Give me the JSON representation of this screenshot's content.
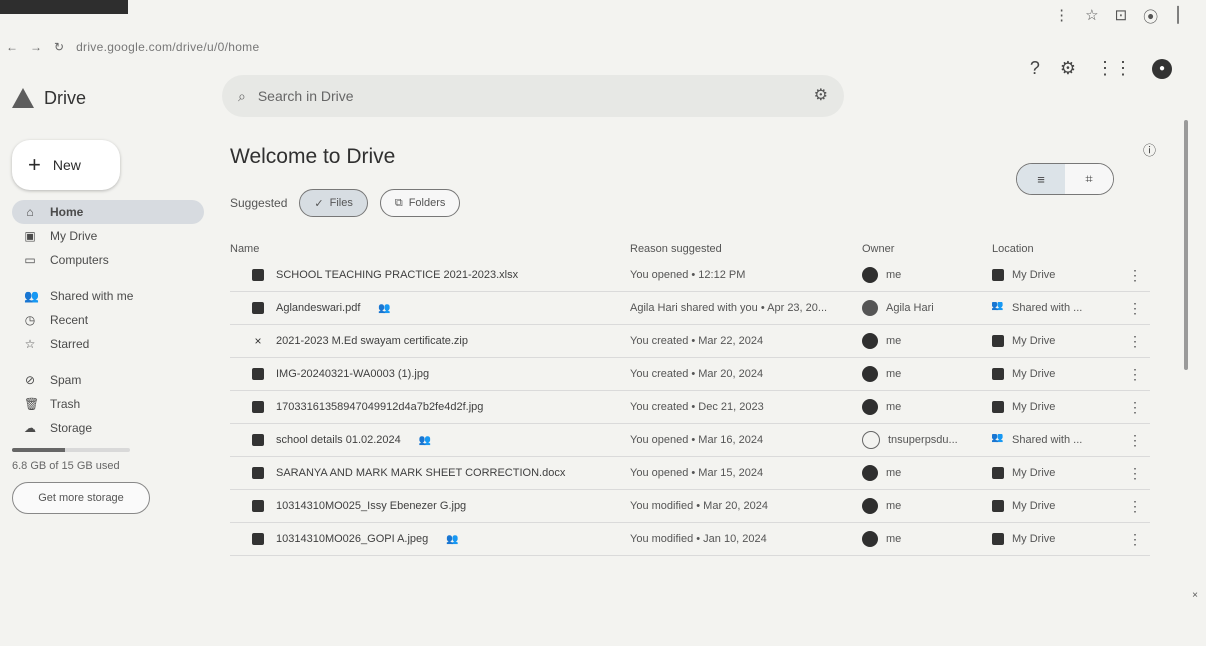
{
  "browser": {
    "url": "drive.google.com/drive/u/0/home",
    "nav": {
      "back": "←",
      "forward": "→",
      "reload": "↻"
    },
    "controls": [
      "⋮",
      "☆",
      "⊡",
      "⦿",
      "⎮"
    ]
  },
  "app": {
    "name": "Drive",
    "new_label": "New",
    "search_placeholder": "Search in Drive",
    "title": "Welcome to Drive",
    "suggested_label": "Suggested",
    "chips": [
      {
        "label": "Files",
        "icon": "check-icon",
        "active": true
      },
      {
        "label": "Folders",
        "icon": "folder-icon",
        "active": false
      }
    ],
    "view_toggle": {
      "list_label": "≡",
      "grid_label": "⌗"
    },
    "top_icons": [
      "help-icon",
      "settings-icon",
      "apps-icon",
      "avatar-icon"
    ],
    "info_icon": "info-icon"
  },
  "sidebar": {
    "items": [
      {
        "label": "Home",
        "icon": "home-icon",
        "active": true
      },
      {
        "label": "My Drive",
        "icon": "drive-icon",
        "active": false
      },
      {
        "label": "Computers",
        "icon": "computer-icon",
        "active": false
      },
      {
        "label": "Shared with me",
        "icon": "people-icon",
        "active": false
      },
      {
        "label": "Recent",
        "icon": "clock-icon",
        "active": false
      },
      {
        "label": "Starred",
        "icon": "star-icon",
        "active": false
      },
      {
        "label": "Spam",
        "icon": "spam-icon",
        "active": false
      },
      {
        "label": "Trash",
        "icon": "trash-icon",
        "active": false
      },
      {
        "label": "Storage",
        "icon": "cloud-icon",
        "active": false
      }
    ],
    "storage_text": "6.8 GB of 15 GB used",
    "storage_fraction": 0.45,
    "storage_button": "Get more storage"
  },
  "table": {
    "headers": [
      "Name",
      "Reason suggested",
      "Owner",
      "Location",
      ""
    ],
    "rows": [
      {
        "name": "SCHOOL TEACHING PRACTICE 2021-2023.xlsx",
        "shared": false,
        "reason": "You opened • 12:12 PM",
        "owner": "me",
        "owner_kind": "me",
        "location": "My Drive",
        "location_kind": "drive"
      },
      {
        "name": "Aglandeswari.pdf",
        "shared": true,
        "reason": "Agila Hari shared with you • Apr 23, 20...",
        "owner": "Agila Hari",
        "owner_kind": "other",
        "location": "Shared with ...",
        "location_kind": "shared"
      },
      {
        "name": "2021-2023 M.Ed swayam certificate.zip",
        "shared": false,
        "reason": "You created • Mar 22, 2024",
        "owner": "me",
        "owner_kind": "me",
        "location": "My Drive",
        "location_kind": "drive"
      },
      {
        "name": "IMG-20240321-WA0003 (1).jpg",
        "shared": false,
        "reason": "You created • Mar 20, 2024",
        "owner": "me",
        "owner_kind": "me",
        "location": "My Drive",
        "location_kind": "drive"
      },
      {
        "name": "17033161358947049912d4a7b2fe4d2f.jpg",
        "shared": false,
        "reason": "You created • Dec 21, 2023",
        "owner": "me",
        "owner_kind": "me",
        "location": "My Drive",
        "location_kind": "drive"
      },
      {
        "name": "school details 01.02.2024",
        "shared": true,
        "reason": "You opened • Mar 16, 2024",
        "owner": "tnsuperpsdu...",
        "owner_kind": "logo",
        "location": "Shared with ...",
        "location_kind": "shared"
      },
      {
        "name": "SARANYA AND MARK MARK SHEET CORRECTION.docx",
        "shared": false,
        "reason": "You opened • Mar 15, 2024",
        "owner": "me",
        "owner_kind": "me",
        "location": "My Drive",
        "location_kind": "drive"
      },
      {
        "name": "10314310MO025_Issy Ebenezer G.jpg",
        "shared": false,
        "reason": "You modified • Mar 20, 2024",
        "owner": "me",
        "owner_kind": "me",
        "location": "My Drive",
        "location_kind": "drive"
      },
      {
        "name": "10314310MO026_GOPI A.jpeg",
        "shared": true,
        "reason": "You modified • Jan 10, 2024",
        "owner": "me",
        "owner_kind": "me",
        "location": "My Drive",
        "location_kind": "drive"
      }
    ]
  },
  "colors": {
    "background": "#f3f3f0",
    "surface": "#ffffff",
    "accent": "#d7dbe0",
    "text": "#2b2b2b"
  }
}
